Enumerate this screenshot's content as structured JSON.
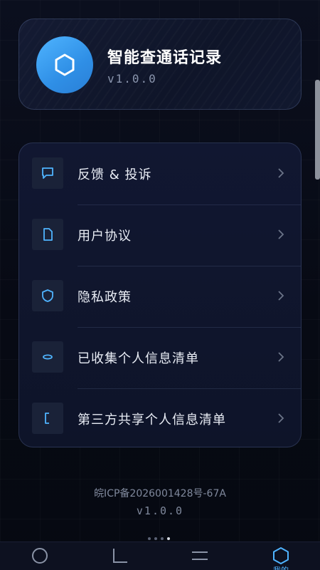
{
  "app": {
    "title": "智能查通话记录",
    "version": "v1.0.0",
    "logo_icon": "hexagon-icon",
    "accent_color": "#4fb4ff"
  },
  "menu": {
    "items": [
      {
        "label": "反馈 & 投诉",
        "icon": "message-icon"
      },
      {
        "label": "用户协议",
        "icon": "document-icon"
      },
      {
        "label": "隐私政策",
        "icon": "shield-icon"
      },
      {
        "label": "已收集个人信息清单",
        "icon": "oval-icon"
      },
      {
        "label": "第三方共享个人信息清单",
        "icon": "bracket-icon"
      }
    ]
  },
  "footer": {
    "icp": "皖ICP备2026001428号-67A",
    "version": "v1.0.0"
  },
  "tabbar": {
    "tabs": [
      {
        "icon": "circle-icon",
        "active": false
      },
      {
        "icon": "corner-icon",
        "active": false
      },
      {
        "icon": "lines-icon",
        "active": false
      },
      {
        "icon": "hexagon-icon",
        "active": true,
        "label": "我的"
      }
    ]
  }
}
